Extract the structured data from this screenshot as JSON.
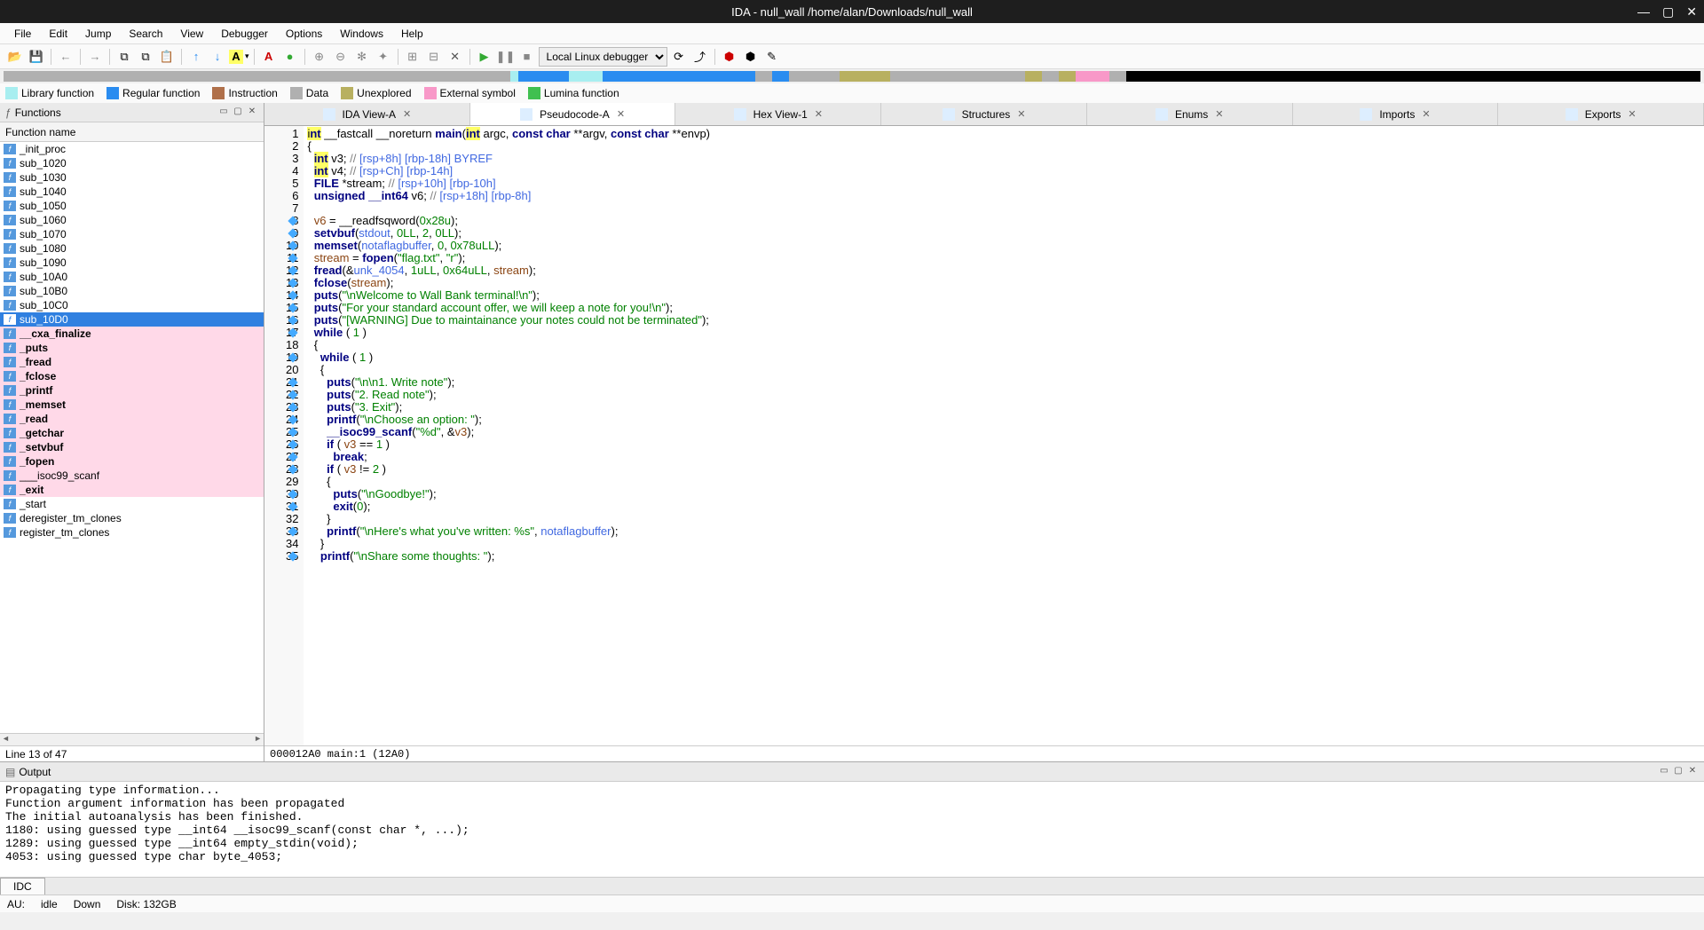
{
  "title": "IDA - null_wall /home/alan/Downloads/null_wall",
  "menu": [
    "File",
    "Edit",
    "Jump",
    "Search",
    "View",
    "Debugger",
    "Options",
    "Windows",
    "Help"
  ],
  "debugger_select": "Local Linux debugger",
  "legend": [
    {
      "color": "#a8eef0",
      "label": "Library function"
    },
    {
      "color": "#2a8cf0",
      "label": "Regular function"
    },
    {
      "color": "#b0704a",
      "label": "Instruction"
    },
    {
      "color": "#b0b0b0",
      "label": "Data"
    },
    {
      "color": "#b8b060",
      "label": "Unexplored"
    },
    {
      "color": "#f898c8",
      "label": "External symbol"
    },
    {
      "color": "#40c050",
      "label": "Lumina function"
    }
  ],
  "functions_panel": {
    "title": "Functions",
    "col": "Function name",
    "items": [
      {
        "name": "_init_proc"
      },
      {
        "name": "sub_1020"
      },
      {
        "name": "sub_1030"
      },
      {
        "name": "sub_1040"
      },
      {
        "name": "sub_1050"
      },
      {
        "name": "sub_1060"
      },
      {
        "name": "sub_1070"
      },
      {
        "name": "sub_1080"
      },
      {
        "name": "sub_1090"
      },
      {
        "name": "sub_10A0"
      },
      {
        "name": "sub_10B0"
      },
      {
        "name": "sub_10C0"
      },
      {
        "name": "sub_10D0",
        "selected": true
      },
      {
        "name": "__cxa_finalize",
        "pink": true,
        "bold": true
      },
      {
        "name": "_puts",
        "pink": true,
        "bold": true
      },
      {
        "name": "_fread",
        "pink": true,
        "bold": true
      },
      {
        "name": "_fclose",
        "pink": true,
        "bold": true
      },
      {
        "name": "_printf",
        "pink": true,
        "bold": true
      },
      {
        "name": "_memset",
        "pink": true,
        "bold": true
      },
      {
        "name": "_read",
        "pink": true,
        "bold": true
      },
      {
        "name": "_getchar",
        "pink": true,
        "bold": true
      },
      {
        "name": "_setvbuf",
        "pink": true,
        "bold": true
      },
      {
        "name": "_fopen",
        "pink": true,
        "bold": true
      },
      {
        "name": "___isoc99_scanf",
        "pink": true
      },
      {
        "name": "_exit",
        "pink": true,
        "bold": true
      },
      {
        "name": "_start"
      },
      {
        "name": "deregister_tm_clones"
      },
      {
        "name": "register_tm_clones"
      }
    ],
    "status": "Line 13 of 47"
  },
  "tabs": [
    {
      "label": "IDA View-A"
    },
    {
      "label": "Pseudocode-A",
      "active": true
    },
    {
      "label": "Hex View-1"
    },
    {
      "label": "Structures"
    },
    {
      "label": "Enums"
    },
    {
      "label": "Imports"
    },
    {
      "label": "Exports"
    }
  ],
  "code_lines": [
    {
      "n": 1,
      "html": "<span class='hl-yellow'>i<span class='kw'>nt</span></span> __fastcall __noreturn <span class='fn'>main</span>(<span class='hl-yellow kw'>int</span> argc, <span class='kw'>const char</span> **argv, <span class='kw'>const char</span> **envp)"
    },
    {
      "n": 2,
      "html": "{"
    },
    {
      "n": 3,
      "html": "  <span class='hl-yellow kw'>int</span> v3; <span class='cm'>//</span> <span class='cm2'>[rsp+8h] [rbp-18h] BYREF</span>"
    },
    {
      "n": 4,
      "html": "  <span class='hl-yellow kw'>int</span> v4; <span class='cm'>//</span> <span class='cm2'>[rsp+Ch] [rbp-14h]</span>"
    },
    {
      "n": 5,
      "html": "  <span class='kw'>FILE</span> *stream; <span class='cm'>//</span> <span class='cm2'>[rsp+10h] [rbp-10h]</span>"
    },
    {
      "n": 6,
      "html": "  <span class='kw'>unsigned</span> <span class='kw'>__int64</span> v6; <span class='cm'>//</span> <span class='cm2'>[rsp+18h] [rbp-8h]</span>"
    },
    {
      "n": 7,
      "html": ""
    },
    {
      "n": 8,
      "bp": true,
      "html": "  <span class='va'>v6</span> = __readfsqword(<span class='nu'>0x28u</span>);"
    },
    {
      "n": 9,
      "bp": true,
      "html": "  <span class='fn'>setvbuf</span>(<span class='id2'>stdout</span>, <span class='nu'>0LL</span>, <span class='nu'>2</span>, <span class='nu'>0LL</span>);"
    },
    {
      "n": 10,
      "bp": true,
      "html": "  <span class='fn'>memset</span>(<span class='id2'>notaflagbuffer</span>, <span class='nu'>0</span>, <span class='nu'>0x78uLL</span>);"
    },
    {
      "n": 11,
      "bp": true,
      "html": "  <span class='va'>stream</span> = <span class='fn'>fopen</span>(<span class='st'>\"flag.txt\"</span>, <span class='st'>\"r\"</span>);"
    },
    {
      "n": 12,
      "bp": true,
      "html": "  <span class='fn'>fread</span>(&amp;<span class='id2'>unk_4054</span>, <span class='nu'>1uLL</span>, <span class='nu'>0x64uLL</span>, <span class='va'>stream</span>);"
    },
    {
      "n": 13,
      "bp": true,
      "html": "  <span class='fn'>fclose</span>(<span class='va'>stream</span>);"
    },
    {
      "n": 14,
      "bp": true,
      "html": "  <span class='fn'>puts</span>(<span class='st'>\"\\nWelcome to Wall Bank terminal!\\n\"</span>);"
    },
    {
      "n": 15,
      "bp": true,
      "html": "  <span class='fn'>puts</span>(<span class='st'>\"For your standard account offer, we will keep a note for you!\\n\"</span>);"
    },
    {
      "n": 16,
      "bp": true,
      "html": "  <span class='fn'>puts</span>(<span class='st'>\"[WARNING] Due to maintainance your notes could not be terminated\"</span>);"
    },
    {
      "n": 17,
      "bp": true,
      "html": "  <span class='kw'>while</span> ( <span class='nu'>1</span> )"
    },
    {
      "n": 18,
      "html": "  {"
    },
    {
      "n": 19,
      "bp": true,
      "html": "    <span class='kw'>while</span> ( <span class='nu'>1</span> )"
    },
    {
      "n": 20,
      "html": "    {"
    },
    {
      "n": 21,
      "bp": true,
      "html": "      <span class='fn'>puts</span>(<span class='st'>\"\\n\\n1. Write note\"</span>);"
    },
    {
      "n": 22,
      "bp": true,
      "html": "      <span class='fn'>puts</span>(<span class='st'>\"2. Read note\"</span>);"
    },
    {
      "n": 23,
      "bp": true,
      "html": "      <span class='fn'>puts</span>(<span class='st'>\"3. Exit\"</span>);"
    },
    {
      "n": 24,
      "bp": true,
      "html": "      <span class='fn'>printf</span>(<span class='st'>\"\\nChoose an option: \"</span>);"
    },
    {
      "n": 25,
      "bp": true,
      "html": "      <span class='fn'>__isoc99_scanf</span>(<span class='st'>\"%d\"</span>, &amp;<span class='va'>v3</span>);"
    },
    {
      "n": 26,
      "bp": true,
      "html": "      <span class='kw'>if</span> ( <span class='va'>v3</span> == <span class='nu'>1</span> )"
    },
    {
      "n": 27,
      "bp": true,
      "html": "        <span class='kw'>break</span>;"
    },
    {
      "n": 28,
      "bp": true,
      "html": "      <span class='kw'>if</span> ( <span class='va'>v3</span> != <span class='nu'>2</span> )"
    },
    {
      "n": 29,
      "html": "      {"
    },
    {
      "n": 30,
      "bp": true,
      "html": "        <span class='fn'>puts</span>(<span class='st'>\"\\nGoodbye!\"</span>);"
    },
    {
      "n": 31,
      "bp": true,
      "html": "        <span class='fn'>exit</span>(<span class='nu'>0</span>);"
    },
    {
      "n": 32,
      "html": "      }"
    },
    {
      "n": 33,
      "bp": true,
      "html": "      <span class='fn'>printf</span>(<span class='st'>\"\\nHere's what you've written: %s\"</span>, <span class='id2'>notaflagbuffer</span>);"
    },
    {
      "n": 34,
      "html": "    }"
    },
    {
      "n": 35,
      "bp": true,
      "html": "    <span class='fn'>printf</span>(<span class='st'>\"\\nShare some thoughts: \"</span>);"
    }
  ],
  "code_status": "000012A0 main:1 (12A0)",
  "output": {
    "title": "Output",
    "lines": [
      "Propagating type information...",
      "Function argument information has been propagated",
      "The initial autoanalysis has been finished.",
      "1180: using guessed type __int64 __isoc99_scanf(const char *, ...);",
      "1289: using guessed type __int64 empty_stdin(void);",
      "4053: using guessed type char byte_4053;"
    ],
    "tab": "IDC"
  },
  "status": {
    "au": "AU:",
    "idle": "idle",
    "down": "Down",
    "disk": "Disk: 132GB"
  },
  "overview": [
    {
      "c": "#b0b0b0",
      "w": 30
    },
    {
      "c": "#a8eef0",
      "w": 0.5
    },
    {
      "c": "#2a8cf0",
      "w": 3
    },
    {
      "c": "#a8eef0",
      "w": 2
    },
    {
      "c": "#2a8cf0",
      "w": 9
    },
    {
      "c": "#b0b0b0",
      "w": 1
    },
    {
      "c": "#2a8cf0",
      "w": 1
    },
    {
      "c": "#b0b0b0",
      "w": 3
    },
    {
      "c": "#b8b060",
      "w": 3
    },
    {
      "c": "#b0b0b0",
      "w": 8
    },
    {
      "c": "#b8b060",
      "w": 1
    },
    {
      "c": "#b0b0b0",
      "w": 1
    },
    {
      "c": "#b8b060",
      "w": 1
    },
    {
      "c": "#f898c8",
      "w": 2
    },
    {
      "c": "#b0b0b0",
      "w": 1
    },
    {
      "c": "#000000",
      "w": 34
    }
  ]
}
